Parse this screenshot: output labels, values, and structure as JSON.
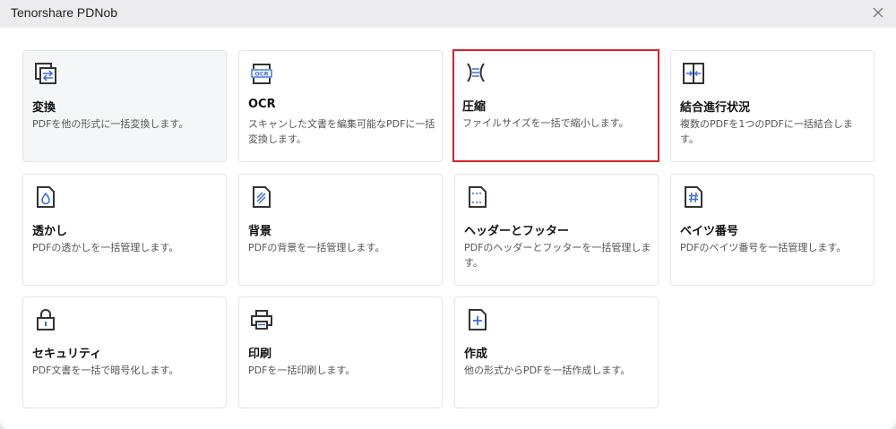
{
  "window": {
    "title": "Tenorshare PDNob"
  },
  "tools": [
    {
      "name": "変換",
      "desc": "PDFを他の形式に一括変換します。",
      "icon": "convert-icon"
    },
    {
      "name": "OCR",
      "desc": "スキャンした文書を編集可能なPDFに一括変換します。",
      "icon": "ocr-icon"
    },
    {
      "name": "圧縮",
      "desc": "ファイルサイズを一括で縮小します。",
      "icon": "compress-icon"
    },
    {
      "name": "結合進行状況",
      "desc": "複数のPDFを1つのPDFに一括結合します。",
      "icon": "merge-icon"
    },
    {
      "name": "透かし",
      "desc": "PDFの透かしを一括管理します。",
      "icon": "watermark-icon"
    },
    {
      "name": "背景",
      "desc": "PDFの背景を一括管理します。",
      "icon": "background-icon"
    },
    {
      "name": "ヘッダーとフッター",
      "desc": "PDFのヘッダーとフッターを一括管理します。",
      "icon": "header-footer-icon"
    },
    {
      "name": "ベイツ番号",
      "desc": "PDFのベイツ番号を一括管理します。",
      "icon": "bates-number-icon"
    },
    {
      "name": "セキュリティ",
      "desc": "PDF文書を一括で暗号化します。",
      "icon": "lock-icon"
    },
    {
      "name": "印刷",
      "desc": "PDFを一括印刷します。",
      "icon": "printer-icon"
    },
    {
      "name": "作成",
      "desc": "他の形式からPDFを一括作成します。",
      "icon": "create-icon"
    }
  ],
  "colors": {
    "accent": "#3b6fe0",
    "selected_border": "#d9202a",
    "icon_stroke": "#333333"
  }
}
